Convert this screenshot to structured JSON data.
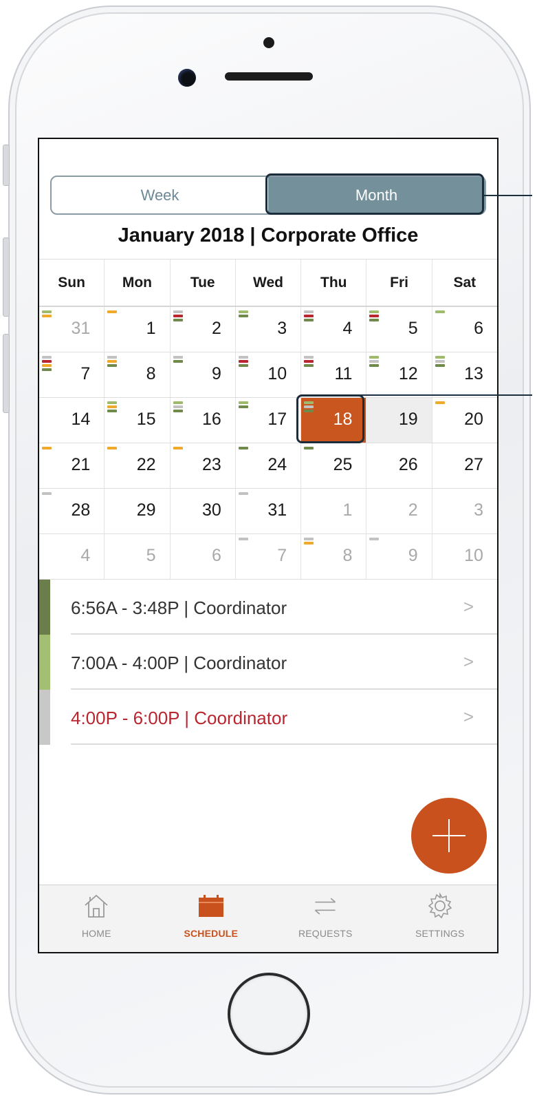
{
  "segment": {
    "week_label": "Week",
    "month_label": "Month",
    "active": "Month"
  },
  "header": {
    "title": "January 2018 | Corporate Office"
  },
  "calendar": {
    "weekdays": [
      "Sun",
      "Mon",
      "Tue",
      "Wed",
      "Thu",
      "Fri",
      "Sat"
    ],
    "selected_day": "18",
    "colors": {
      "green": "#6f8a4a",
      "lightgreen": "#9dbb6b",
      "red": "#b8262f",
      "orange": "#f0a92b",
      "gray": "#c2c2c2",
      "selected": "#c9561f"
    },
    "weeks": [
      [
        {
          "day": "31",
          "outside": true,
          "marks": [
            "lightgreen",
            "orange"
          ]
        },
        {
          "day": "1",
          "marks": [
            "orange"
          ]
        },
        {
          "day": "2",
          "marks": [
            "gray",
            "red",
            "green"
          ]
        },
        {
          "day": "3",
          "marks": [
            "lightgreen",
            "green"
          ]
        },
        {
          "day": "4",
          "marks": [
            "gray",
            "red",
            "green"
          ]
        },
        {
          "day": "5",
          "marks": [
            "lightgreen",
            "red",
            "green"
          ]
        },
        {
          "day": "6",
          "marks": [
            "lightgreen"
          ]
        }
      ],
      [
        {
          "day": "7",
          "marks": [
            "gray",
            "red",
            "orange",
            "green"
          ]
        },
        {
          "day": "8",
          "marks": [
            "gray",
            "orange",
            "green"
          ]
        },
        {
          "day": "9",
          "marks": [
            "gray",
            "green"
          ]
        },
        {
          "day": "10",
          "marks": [
            "gray",
            "red",
            "green"
          ]
        },
        {
          "day": "11",
          "marks": [
            "gray",
            "red",
            "green"
          ]
        },
        {
          "day": "12",
          "marks": [
            "lightgreen",
            "gray",
            "green"
          ]
        },
        {
          "day": "13",
          "marks": [
            "lightgreen",
            "gray",
            "green"
          ]
        }
      ],
      [
        {
          "day": "14",
          "marks": []
        },
        {
          "day": "15",
          "marks": [
            "lightgreen",
            "orange",
            "green"
          ]
        },
        {
          "day": "16",
          "marks": [
            "lightgreen",
            "gray",
            "green"
          ]
        },
        {
          "day": "17",
          "marks": [
            "lightgreen",
            "green"
          ]
        },
        {
          "day": "18",
          "selected": true,
          "marks": [
            "lightgreen",
            "gray",
            "green"
          ]
        },
        {
          "day": "19",
          "tinted": true,
          "marks": []
        },
        {
          "day": "20",
          "marks": [
            "orange"
          ]
        }
      ],
      [
        {
          "day": "21",
          "marks": [
            "orange"
          ]
        },
        {
          "day": "22",
          "marks": [
            "orange"
          ]
        },
        {
          "day": "23",
          "marks": [
            "orange"
          ]
        },
        {
          "day": "24",
          "marks": [
            "green"
          ]
        },
        {
          "day": "25",
          "marks": [
            "green"
          ]
        },
        {
          "day": "26",
          "marks": []
        },
        {
          "day": "27",
          "marks": []
        }
      ],
      [
        {
          "day": "28",
          "marks": [
            "gray"
          ]
        },
        {
          "day": "29",
          "marks": []
        },
        {
          "day": "30",
          "marks": []
        },
        {
          "day": "31",
          "marks": [
            "gray"
          ]
        },
        {
          "day": "1",
          "outside": true,
          "marks": []
        },
        {
          "day": "2",
          "outside": true,
          "marks": []
        },
        {
          "day": "3",
          "outside": true,
          "marks": []
        }
      ],
      [
        {
          "day": "4",
          "outside": true,
          "marks": []
        },
        {
          "day": "5",
          "outside": true,
          "marks": []
        },
        {
          "day": "6",
          "outside": true,
          "marks": []
        },
        {
          "day": "7",
          "outside": true,
          "marks": [
            "gray"
          ]
        },
        {
          "day": "8",
          "outside": true,
          "marks": [
            "gray",
            "orange"
          ]
        },
        {
          "day": "9",
          "outside": true,
          "marks": [
            "gray"
          ]
        },
        {
          "day": "10",
          "outside": true,
          "marks": []
        }
      ]
    ]
  },
  "shifts": [
    {
      "text": "6:56A - 3:48P | Coordinator",
      "bar_color": "#6b7d4a",
      "text_color": "#333333"
    },
    {
      "text": "7:00A - 4:00P | Coordinator",
      "bar_color": "#a3c072",
      "text_color": "#333333"
    },
    {
      "text": "4:00P - 6:00P | Coordinator",
      "bar_color": "#c8c8c8",
      "text_color": "#b8262f"
    }
  ],
  "fab": {
    "icon": "plus-icon"
  },
  "tabbar": {
    "home": "HOME",
    "schedule": "SCHEDULE",
    "requests": "REQUESTS",
    "settings": "SETTINGS",
    "active": "SCHEDULE",
    "active_color": "#c9511d"
  }
}
